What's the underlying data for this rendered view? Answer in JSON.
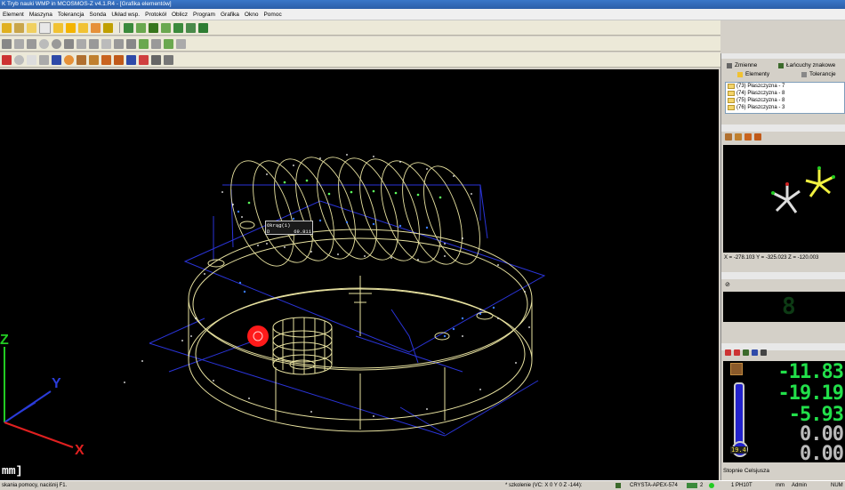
{
  "window": {
    "title": "K Tryb nauki WMP in MCOSMOS-Z v4.1.R4  - [Grafika elementów]"
  },
  "menu": {
    "items": [
      "Element",
      "Maszyna",
      "Tolerancja",
      "Sonda",
      "Układ wsp.",
      "Protokół",
      "Oblicz",
      "Program",
      "Grafika",
      "Okno",
      "Pomoc"
    ]
  },
  "viewport": {
    "axis_z": "Z",
    "axis_y": "Y",
    "axis_x": "X",
    "tooltip_title": "Okrąg(1)",
    "tooltip_left": "D",
    "tooltip_value": "69.811",
    "unit_line": "mm]"
  },
  "right_panel": {
    "tab_variables": "Zmienne",
    "tab_chains": "Łańcuchy znakowe",
    "tab_elements": "Elementy",
    "tab_tolerances": "Tolerancje",
    "tree_items": [
      "(73) Płaszczyzna - 7",
      "(74) Płaszczyzna - 8",
      "(75) Płaszczyzna - 8",
      "(76) Płaszczyzna - 3"
    ],
    "coords": "X = -278.103 Y = -325.023 Z = -120.003",
    "probe_count": "8",
    "temperature": "19.4",
    "temp_unit": "Stopnie Celsjusza",
    "dro": {
      "x": "-11.83",
      "y": "-19.19",
      "z": "-5.93",
      "r1": "0.00",
      "r2": "0.00"
    }
  },
  "status": {
    "help": "skania pomocy, naciśnij F1.",
    "mode": "* szkolenie (VC: X 0 Y 0 Z -144):",
    "machine": "CRYSTA-APEX-574",
    "probe_idx": "2",
    "probe": "1 PH10T",
    "unit": "mm",
    "user": "Admin",
    "num": "NUM"
  },
  "colors": {
    "viewport_bg": "#000000",
    "wireframe": "#e8e2a0",
    "blue_lines": "#2a34d8",
    "dro_green": "#22e04a",
    "probe_red": "#ff1a1a"
  }
}
